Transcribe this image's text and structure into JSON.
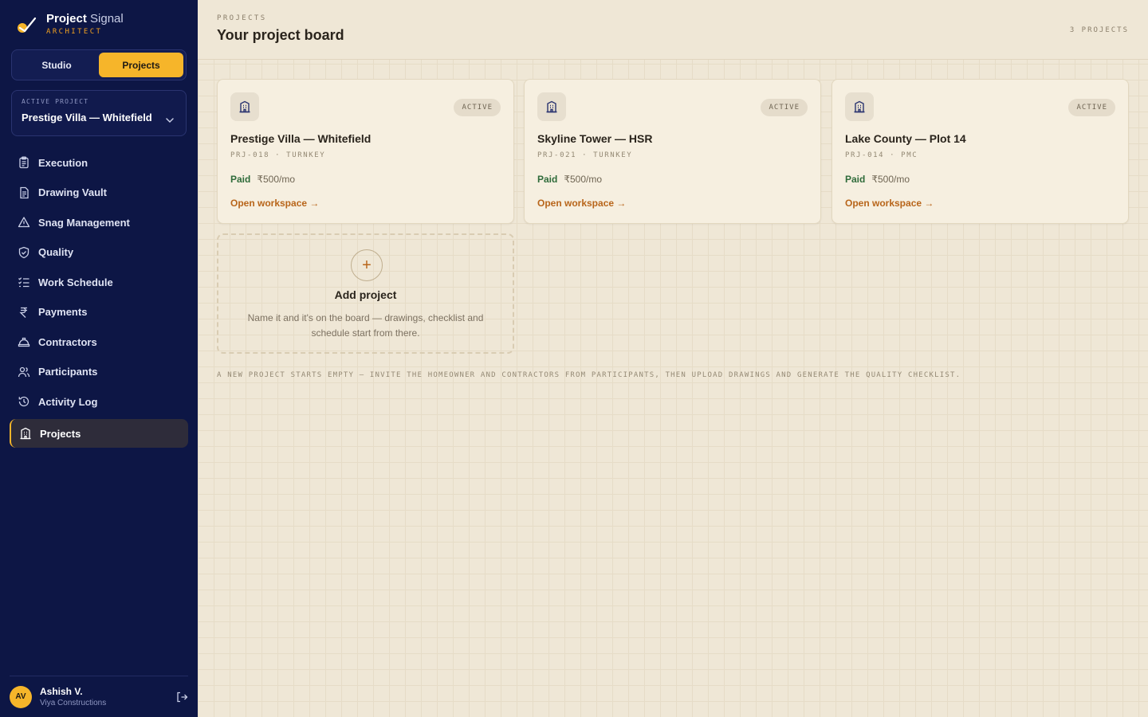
{
  "brand": {
    "name_bold": "Project",
    "name_light": "Signal",
    "role": "ARCHITECT"
  },
  "mode_toggle": {
    "options": [
      "Studio",
      "Projects"
    ],
    "selected": "Projects"
  },
  "active_project": {
    "label": "ACTIVE PROJECT",
    "value": "Prestige Villa — Whitefield"
  },
  "nav": {
    "items": [
      {
        "label": "Execution",
        "icon": "clipboard-icon"
      },
      {
        "label": "Drawing Vault",
        "icon": "document-icon"
      },
      {
        "label": "Snag Management",
        "icon": "warning-icon"
      },
      {
        "label": "Quality",
        "icon": "shield-check-icon"
      },
      {
        "label": "Work Schedule",
        "icon": "list-check-icon"
      },
      {
        "label": "Payments",
        "icon": "rupee-icon"
      },
      {
        "label": "Contractors",
        "icon": "hard-hat-icon"
      },
      {
        "label": "Participants",
        "icon": "users-icon"
      },
      {
        "label": "Activity Log",
        "icon": "history-icon"
      },
      {
        "label": "Projects",
        "icon": "building-icon",
        "active": true
      }
    ]
  },
  "user": {
    "initials": "AV",
    "name": "Ashish V.",
    "org": "Viya Constructions"
  },
  "header": {
    "eyebrow": "PROJECTS",
    "title": "Your project board",
    "count": "3 PROJECTS"
  },
  "projects": [
    {
      "status": "ACTIVE",
      "title": "Prestige Villa — Whitefield",
      "meta": "PRJ-018 · TURNKEY",
      "paid": "Paid",
      "price": "₹500/mo",
      "link": "Open workspace →"
    },
    {
      "status": "ACTIVE",
      "title": "Skyline Tower — HSR",
      "meta": "PRJ-021 · TURNKEY",
      "paid": "Paid",
      "price": "₹500/mo",
      "link": "Open workspace →"
    },
    {
      "status": "ACTIVE",
      "title": "Lake County — Plot 14",
      "meta": "PRJ-014 · PMC",
      "paid": "Paid",
      "price": "₹500/mo",
      "link": "Open workspace →"
    }
  ],
  "add_project": {
    "title": "Add project",
    "description": "Name it and it's on the board — drawings, checklist and schedule start from there."
  },
  "footer_note": "A NEW PROJECT STARTS EMPTY — INVITE THE HOMEOWNER AND CONTRACTORS FROM PARTICIPANTS, THEN UPLOAD DRAWINGS AND GENERATE THE QUALITY CHECKLIST.",
  "colors": {
    "sidebar": "#0d1645",
    "accent": "#f6b52a",
    "link": "#b8651a",
    "paid": "#2f6b3a",
    "canvas": "#efe7d6"
  }
}
